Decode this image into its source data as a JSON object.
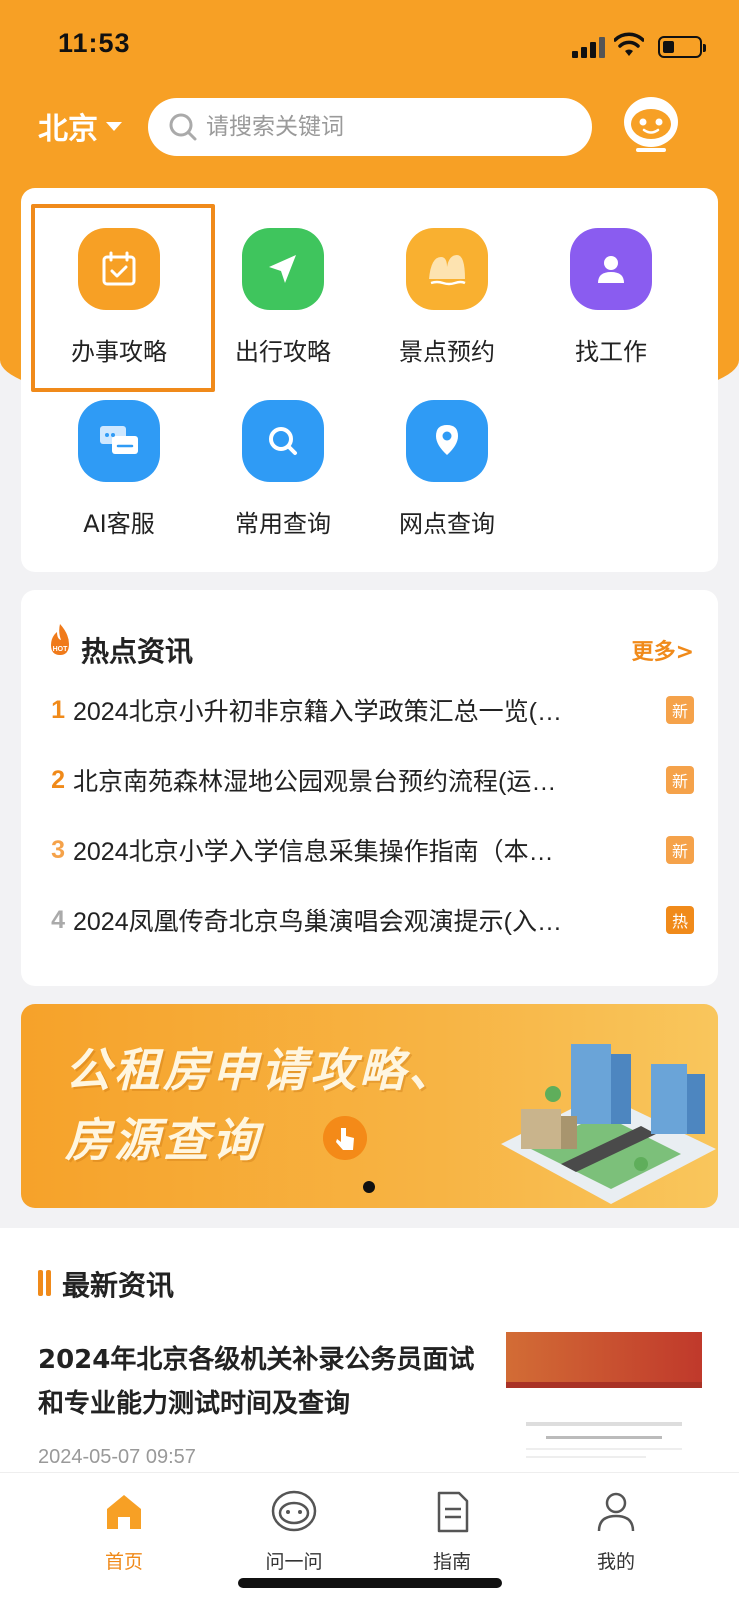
{
  "status_bar": {
    "time": "11:53"
  },
  "header": {
    "city": "北京",
    "search_placeholder": "请搜索关键词"
  },
  "services": [
    {
      "label": "办事攻略",
      "icon": "calendar-check-icon",
      "color": "#f7a025"
    },
    {
      "label": "出行攻略",
      "icon": "send-arrow-icon",
      "color": "#3fc55d"
    },
    {
      "label": "景点预约",
      "icon": "mountain-icon",
      "color": "#f7a025"
    },
    {
      "label": "找工作",
      "icon": "person-icon",
      "color": "#8a5cf0"
    },
    {
      "label": "AI客服",
      "icon": "chat-bubbles-icon",
      "color": "#2f9bf5"
    },
    {
      "label": "常用查询",
      "icon": "magnifier-icon",
      "color": "#2f9bf5"
    },
    {
      "label": "网点查询",
      "icon": "location-pin-icon",
      "color": "#2f9bf5"
    }
  ],
  "hot_news": {
    "title": "热点资讯",
    "more_label": "更多>",
    "items": [
      {
        "num": "1",
        "title": "2024北京小升初非京籍入学政策汇总一览(…",
        "badge": "新",
        "num_color": "#f08a1a",
        "badge_color": "#f5a24a"
      },
      {
        "num": "2",
        "title": "北京南苑森林湿地公园观景台预约流程(运…",
        "badge": "新",
        "num_color": "#f08a1a",
        "badge_color": "#f5a24a"
      },
      {
        "num": "3",
        "title": "2024北京小学入学信息采集操作指南（本…",
        "badge": "新",
        "num_color": "#f5a24a",
        "badge_color": "#f5a24a"
      },
      {
        "num": "4",
        "title": "2024凤凰传奇北京鸟巢演唱会观演提示(入…",
        "badge": "热",
        "num_color": "#aaaaaa",
        "badge_color": "#f08a1a"
      }
    ]
  },
  "banner": {
    "line1": "公租房申请攻略、",
    "line2": "房源查询"
  },
  "latest_news": {
    "title": "最新资讯",
    "article_title": "2024年北京各级机关补录公务员面试和专业能力测试时间及查询",
    "article_date": "2024-05-07 09:57"
  },
  "tabbar": [
    {
      "label": "首页",
      "icon": "home-icon",
      "active": true
    },
    {
      "label": "问一问",
      "icon": "robot-icon",
      "active": false
    },
    {
      "label": "指南",
      "icon": "document-icon",
      "active": false
    },
    {
      "label": "我的",
      "icon": "user-icon",
      "active": false
    }
  ],
  "colors": {
    "brand": "#f7a025",
    "accent": "#f08a1a"
  }
}
